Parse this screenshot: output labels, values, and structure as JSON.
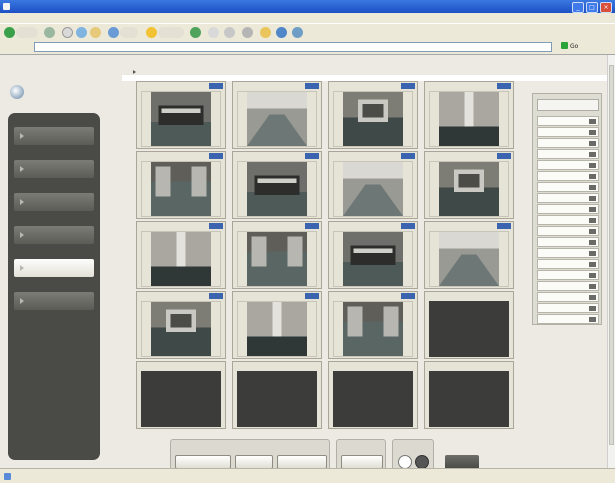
{
  "browser": {
    "title": "",
    "menu": [
      "",
      "",
      "",
      "",
      "",
      ""
    ],
    "address_label": "",
    "address": "",
    "go_label": "Go",
    "links_label": "",
    "status_text": "",
    "zone_text": ""
  },
  "app": {
    "title": "",
    "breadcrumb": ""
  },
  "sidebar": {
    "items": [
      {
        "label": "",
        "active": false
      },
      {
        "label": "",
        "active": false
      },
      {
        "label": "",
        "active": false
      },
      {
        "label": "",
        "active": false
      },
      {
        "label": "",
        "active": true
      },
      {
        "label": "",
        "active": false
      }
    ]
  },
  "cameras": [
    {
      "label": "",
      "live": true
    },
    {
      "label": "",
      "live": true
    },
    {
      "label": "",
      "live": true
    },
    {
      "label": "",
      "live": true
    },
    {
      "label": "",
      "live": true
    },
    {
      "label": "",
      "live": true
    },
    {
      "label": "",
      "live": true
    },
    {
      "label": "",
      "live": true
    },
    {
      "label": "",
      "live": true
    },
    {
      "label": "",
      "live": true
    },
    {
      "label": "",
      "live": true
    },
    {
      "label": "",
      "live": true
    },
    {
      "label": "",
      "live": true
    },
    {
      "label": "",
      "live": true
    },
    {
      "label": "",
      "live": true
    },
    {
      "label": "",
      "live": false
    },
    {
      "label": "",
      "live": false
    },
    {
      "label": "",
      "live": false
    },
    {
      "label": "",
      "live": false
    },
    {
      "label": "",
      "live": false
    }
  ],
  "list_panel": {
    "header": "",
    "items": [
      "",
      "",
      "",
      "",
      "",
      "",
      "",
      "",
      "",
      "",
      "",
      "",
      "",
      "",
      "",
      "",
      "",
      "",
      ""
    ]
  },
  "controls": {
    "group1_label": "",
    "group1_buttons": [
      "",
      "",
      ""
    ],
    "group2_label": "",
    "group2_button": "",
    "group3_label": "",
    "toggle_on": "",
    "toggle_off": "",
    "update_button": ""
  },
  "colors": {
    "title_bar": "#1d4fc4",
    "sidebar": "#4a4a46",
    "cam_status": "#3a63b0",
    "go_icon": "#29a43a"
  }
}
